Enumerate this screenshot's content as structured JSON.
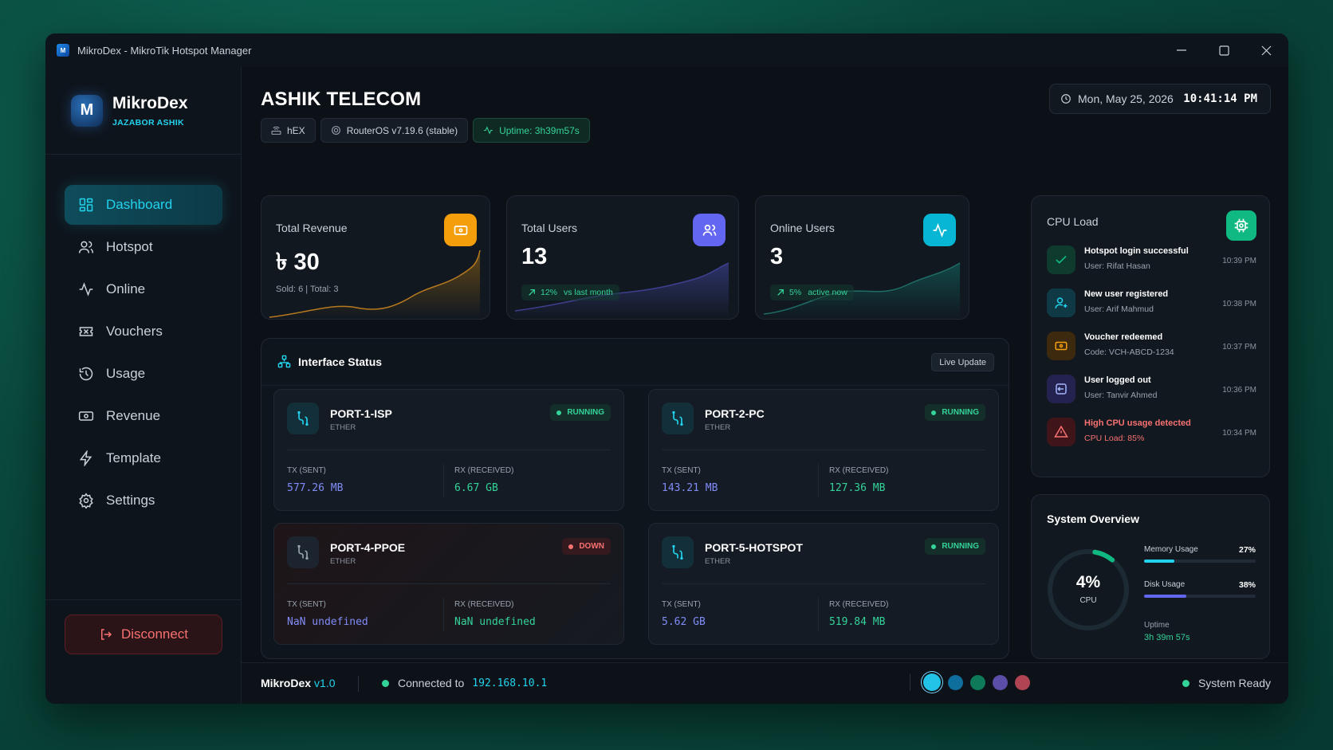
{
  "window": {
    "title": "MikroDex - MikroTik Hotspot Manager"
  },
  "brand": {
    "name": "MikroDex",
    "subtitle": "JAZABOR ASHIK",
    "logo_text": "M"
  },
  "nav": [
    {
      "label": "Dashboard",
      "icon": "dashboard-icon",
      "active": true
    },
    {
      "label": "Hotspot",
      "icon": "users-icon"
    },
    {
      "label": "Online",
      "icon": "activity-icon"
    },
    {
      "label": "Vouchers",
      "icon": "ticket-icon"
    },
    {
      "label": "Usage",
      "icon": "history-icon"
    },
    {
      "label": "Revenue",
      "icon": "banknote-icon"
    },
    {
      "label": "Template",
      "icon": "zap-icon"
    },
    {
      "label": "Settings",
      "icon": "gear-icon"
    }
  ],
  "disconnect_label": "Disconnect",
  "header": {
    "title": "ASHIK TELECOM",
    "chips": {
      "device": "hEX",
      "os": "RouterOS v7.19.6 (stable)",
      "uptime": "Uptime: 3h39m57s"
    },
    "date": "Mon, May 25, 2026",
    "time": "10:41:14 PM"
  },
  "stats": {
    "revenue": {
      "label": "Total Revenue",
      "value": "৳ 30",
      "footer": "Sold: 6 | Total: 3",
      "color": "#f59e0b"
    },
    "users": {
      "label": "Total Users",
      "value": "13",
      "trend": "12%",
      "trend_label": "vs last month",
      "color": "#6366f1"
    },
    "online": {
      "label": "Online Users",
      "value": "3",
      "trend": "5%",
      "trend_label": "active now",
      "color": "#06b6d4"
    }
  },
  "interfaces": {
    "title": "Interface Status",
    "live_label": "Live Update",
    "tx_label": "TX (SENT)",
    "rx_label": "RX (RECEIVED)",
    "ports": [
      {
        "name": "PORT-1-ISP",
        "type": "ETHER",
        "status": "RUNNING",
        "tx": "577.26 MB",
        "rx": "6.67 GB"
      },
      {
        "name": "PORT-2-PC",
        "type": "ETHER",
        "status": "RUNNING",
        "tx": "143.21 MB",
        "rx": "127.36 MB"
      },
      {
        "name": "PORT-4-PPOE",
        "type": "ETHER",
        "status": "DOWN",
        "tx": "NaN undefined",
        "rx": "NaN undefined"
      },
      {
        "name": "PORT-5-HOTSPOT",
        "type": "ETHER",
        "status": "RUNNING",
        "tx": "5.62 GB",
        "rx": "519.84 MB"
      }
    ]
  },
  "cpu_panel": {
    "title": "CPU Load",
    "activities": [
      {
        "title": "Hotspot login successful",
        "sub": "User: Rifat Hasan",
        "time": "10:39 PM",
        "icon": "check-icon",
        "color": "#10b981"
      },
      {
        "title": "New user registered",
        "sub": "User: Arif Mahmud",
        "time": "10:38 PM",
        "icon": "user-plus-icon",
        "color": "#0ea5b7"
      },
      {
        "title": "Voucher redeemed",
        "sub": "Code: VCH-ABCD-1234",
        "time": "10:37 PM",
        "icon": "voucher-icon",
        "color": "#f59e0b"
      },
      {
        "title": "User logged out",
        "sub": "User: Tanvir Ahmed",
        "time": "10:36 PM",
        "icon": "logout-icon",
        "color": "#6366f1"
      },
      {
        "title": "High CPU usage detected",
        "sub": "CPU Load: 85%",
        "time": "10:34 PM",
        "icon": "warning-icon",
        "color": "#ef4444"
      }
    ]
  },
  "system": {
    "title": "System Overview",
    "cpu_value": "4%",
    "cpu_label": "CPU",
    "cpu_fraction": 0.04,
    "memory_label": "Memory Usage",
    "memory_pct": "27%",
    "memory_fraction": 0.27,
    "disk_label": "Disk Usage",
    "disk_pct": "38%",
    "disk_fraction": 0.38,
    "uptime_label": "Uptime",
    "uptime_value": "3h 39m 57s"
  },
  "statusbar": {
    "app": "MikroDex",
    "version": "v1.0",
    "connected_label": "Connected to",
    "ip": "192.168.10.1",
    "theme_colors": [
      "#22c3e6",
      "#0e6e9e",
      "#0f7a5a",
      "#5b4ea8",
      "#b04452"
    ],
    "ready": "System Ready"
  }
}
